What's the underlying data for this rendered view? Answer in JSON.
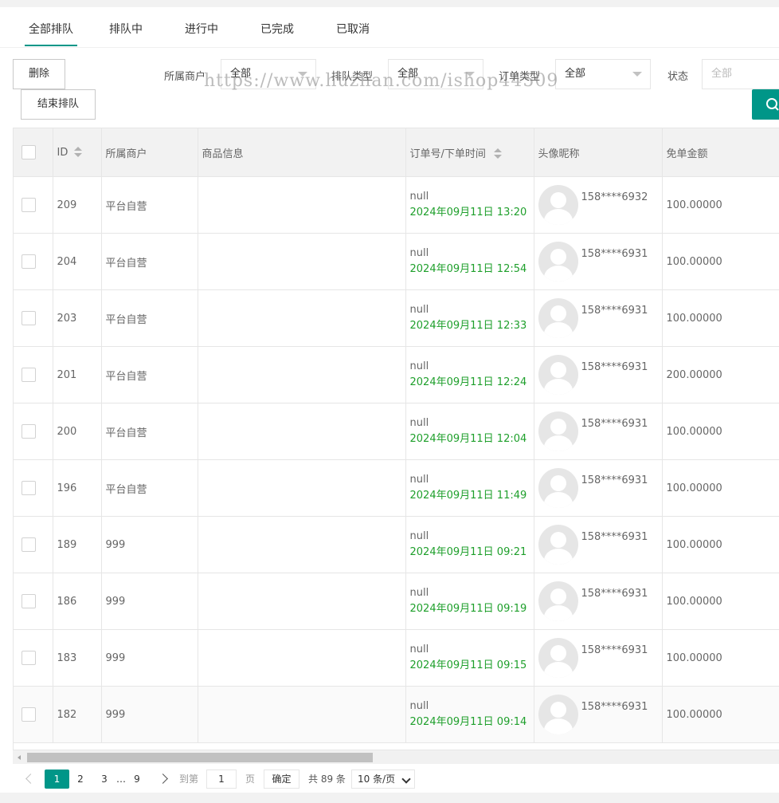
{
  "tabs": [
    {
      "label": "全部排队"
    },
    {
      "label": "排队中"
    },
    {
      "label": "进行中"
    },
    {
      "label": "已完成"
    },
    {
      "label": "已取消"
    }
  ],
  "toolbar": {
    "delete_label": "删除",
    "end_queue_label": "结束排队",
    "filters": {
      "merchant": {
        "label": "所属商户",
        "value": "全部"
      },
      "queue_type": {
        "label": "排队类型",
        "value": "全部"
      },
      "order_type": {
        "label": "订单类型",
        "value": "全部"
      },
      "status": {
        "label": "状态",
        "placeholder": "全部"
      }
    },
    "search_icon": "search-icon"
  },
  "watermark": "https://www.huzhan.com/ishop44509",
  "table": {
    "headers": {
      "id": "ID",
      "merchant": "所属商户",
      "goods": "商品信息",
      "order": "订单号/下单时间",
      "avatar": "头像昵称",
      "free_amount": "免单金额"
    },
    "rows": [
      {
        "id": "209",
        "merchant": "平台自营",
        "goods": "",
        "order_no": "null",
        "time": "2024年09月11日 13:20",
        "nick": "158****6932",
        "amount": "100.00000"
      },
      {
        "id": "204",
        "merchant": "平台自营",
        "goods": "",
        "order_no": "null",
        "time": "2024年09月11日 12:54",
        "nick": "158****6931",
        "amount": "100.00000"
      },
      {
        "id": "203",
        "merchant": "平台自营",
        "goods": "",
        "order_no": "null",
        "time": "2024年09月11日 12:33",
        "nick": "158****6931",
        "amount": "100.00000"
      },
      {
        "id": "201",
        "merchant": "平台自营",
        "goods": "",
        "order_no": "null",
        "time": "2024年09月11日 12:24",
        "nick": "158****6931",
        "amount": "200.00000"
      },
      {
        "id": "200",
        "merchant": "平台自营",
        "goods": "",
        "order_no": "null",
        "time": "2024年09月11日 12:04",
        "nick": "158****6931",
        "amount": "100.00000"
      },
      {
        "id": "196",
        "merchant": "平台自营",
        "goods": "",
        "order_no": "null",
        "time": "2024年09月11日 11:49",
        "nick": "158****6931",
        "amount": "100.00000"
      },
      {
        "id": "189",
        "merchant": "999",
        "goods": "",
        "order_no": "null",
        "time": "2024年09月11日 09:21",
        "nick": "158****6931",
        "amount": "100.00000"
      },
      {
        "id": "186",
        "merchant": "999",
        "goods": "",
        "order_no": "null",
        "time": "2024年09月11日 09:19",
        "nick": "158****6931",
        "amount": "100.00000"
      },
      {
        "id": "183",
        "merchant": "999",
        "goods": "",
        "order_no": "null",
        "time": "2024年09月11日 09:15",
        "nick": "158****6931",
        "amount": "100.00000"
      },
      {
        "id": "182",
        "merchant": "999",
        "goods": "",
        "order_no": "null",
        "time": "2024年09月11日 09:14",
        "nick": "158****6931",
        "amount": "100.00000"
      }
    ]
  },
  "pager": {
    "pages": [
      "1",
      "2",
      "3"
    ],
    "ellipsis": "…",
    "last": "9",
    "goto_prefix": "到第",
    "goto_value": "1",
    "goto_suffix": "页",
    "ok_label": "确定",
    "total": "共 89 条",
    "page_size": "10 条/页"
  },
  "colors": {
    "accent": "#009688",
    "time_green": "#1e9f2b"
  }
}
